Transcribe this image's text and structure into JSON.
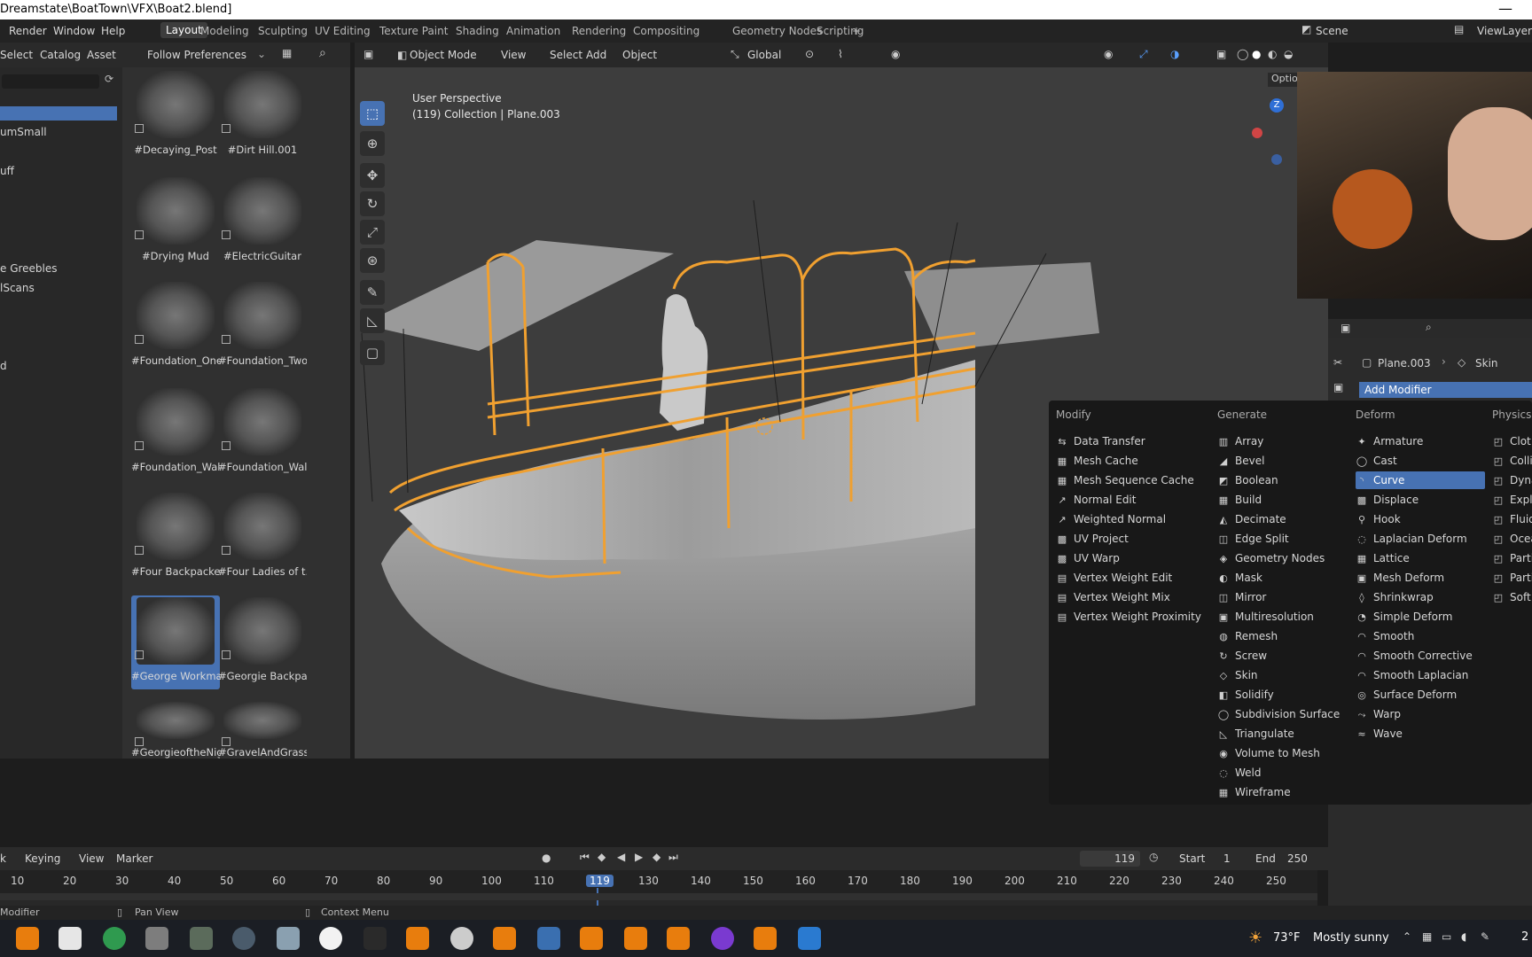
{
  "title_bar": {
    "path": "Dreamstate\\BoatTown\\VFX\\Boat2.blend]",
    "minimize": "—"
  },
  "top_menu": [
    "Render",
    "Window",
    "Help"
  ],
  "workspaces": [
    "Layout",
    "Modeling",
    "Sculpting",
    "UV Editing",
    "Texture Paint",
    "Shading",
    "Animation",
    "Rendering",
    "Compositing",
    "Geometry Nodes",
    "Scripting",
    "+"
  ],
  "scene": {
    "name": "Scene",
    "view_layer": "ViewLayer"
  },
  "asset_browser": {
    "menus": [
      "Select",
      "Catalog",
      "Asset"
    ],
    "import_mode": "Follow Preferences",
    "left_items": [
      "umSmall",
      "uff",
      "e Greebles",
      "lScans",
      "d"
    ],
    "assets": [
      {
        "label": "#Decaying_Post"
      },
      {
        "label": "#Dirt Hill.001"
      },
      {
        "label": "#Drying Mud"
      },
      {
        "label": "#ElectricGuitar"
      },
      {
        "label": "#Foundation_One"
      },
      {
        "label": "#Foundation_Two"
      },
      {
        "label": "#Foundation_Wall"
      },
      {
        "label": "#Foundation_Wal..."
      },
      {
        "label": "#Four Backpackers"
      },
      {
        "label": "#Four Ladies of t..."
      },
      {
        "label": "#George Workma..."
      },
      {
        "label": "#Georgie Backpack"
      },
      {
        "label": "#GeorgieoftheNight"
      },
      {
        "label": "#GravelAndGrass"
      }
    ]
  },
  "viewport": {
    "mode": "Object Mode",
    "menus": [
      "View",
      "Select",
      "Add",
      "Object"
    ],
    "orientation": "Global",
    "perspective": "User Perspective",
    "collection_info": "(119) Collection | Plane.003",
    "options": "Option",
    "axis_z": "Z"
  },
  "properties": {
    "object": "Plane.003",
    "modifier": "Skin",
    "add_modifier": "Add Modifier"
  },
  "modifier_menu": {
    "columns": [
      {
        "header": "Modify",
        "items": [
          {
            "icon": "⇆",
            "label": "Data Transfer"
          },
          {
            "icon": "▦",
            "label": "Mesh Cache"
          },
          {
            "icon": "▦",
            "label": "Mesh Sequence Cache"
          },
          {
            "icon": "↗",
            "label": "Normal Edit"
          },
          {
            "icon": "↗",
            "label": "Weighted Normal"
          },
          {
            "icon": "▩",
            "label": "UV Project"
          },
          {
            "icon": "▩",
            "label": "UV Warp"
          },
          {
            "icon": "▤",
            "label": "Vertex Weight Edit"
          },
          {
            "icon": "▤",
            "label": "Vertex Weight Mix"
          },
          {
            "icon": "▤",
            "label": "Vertex Weight Proximity"
          }
        ]
      },
      {
        "header": "Generate",
        "items": [
          {
            "icon": "▥",
            "label": "Array"
          },
          {
            "icon": "◢",
            "label": "Bevel"
          },
          {
            "icon": "◩",
            "label": "Boolean"
          },
          {
            "icon": "▦",
            "label": "Build"
          },
          {
            "icon": "◭",
            "label": "Decimate"
          },
          {
            "icon": "◫",
            "label": "Edge Split"
          },
          {
            "icon": "◈",
            "label": "Geometry Nodes"
          },
          {
            "icon": "◐",
            "label": "Mask"
          },
          {
            "icon": "◫",
            "label": "Mirror"
          },
          {
            "icon": "▣",
            "label": "Multiresolution"
          },
          {
            "icon": "◍",
            "label": "Remesh"
          },
          {
            "icon": "↻",
            "label": "Screw"
          },
          {
            "icon": "◇",
            "label": "Skin"
          },
          {
            "icon": "◧",
            "label": "Solidify"
          },
          {
            "icon": "◯",
            "label": "Subdivision Surface"
          },
          {
            "icon": "◺",
            "label": "Triangulate"
          },
          {
            "icon": "◉",
            "label": "Volume to Mesh"
          },
          {
            "icon": "◌",
            "label": "Weld"
          },
          {
            "icon": "▦",
            "label": "Wireframe"
          }
        ]
      },
      {
        "header": "Deform",
        "items": [
          {
            "icon": "✦",
            "label": "Armature"
          },
          {
            "icon": "◯",
            "label": "Cast"
          },
          {
            "icon": "◝",
            "label": "Curve"
          },
          {
            "icon": "▩",
            "label": "Displace"
          },
          {
            "icon": "⚲",
            "label": "Hook"
          },
          {
            "icon": "◌",
            "label": "Laplacian Deform"
          },
          {
            "icon": "▦",
            "label": "Lattice"
          },
          {
            "icon": "▣",
            "label": "Mesh Deform"
          },
          {
            "icon": "◊",
            "label": "Shrinkwrap"
          },
          {
            "icon": "◔",
            "label": "Simple Deform"
          },
          {
            "icon": "◠",
            "label": "Smooth"
          },
          {
            "icon": "◠",
            "label": "Smooth Corrective"
          },
          {
            "icon": "◠",
            "label": "Smooth Laplacian"
          },
          {
            "icon": "◎",
            "label": "Surface Deform"
          },
          {
            "icon": "⤳",
            "label": "Warp"
          },
          {
            "icon": "≈",
            "label": "Wave"
          }
        ]
      },
      {
        "header": "Physics",
        "items": [
          {
            "icon": "◰",
            "label": "Clot"
          },
          {
            "icon": "◰",
            "label": "Colli"
          },
          {
            "icon": "◰",
            "label": "Dyna"
          },
          {
            "icon": "◰",
            "label": "Expl"
          },
          {
            "icon": "◰",
            "label": "Fluid"
          },
          {
            "icon": "◰",
            "label": "Ocea"
          },
          {
            "icon": "◰",
            "label": "Parti"
          },
          {
            "icon": "◰",
            "label": "Parti"
          },
          {
            "icon": "◰",
            "label": "Soft"
          }
        ]
      }
    ],
    "highlighted": "Curve"
  },
  "timeline": {
    "menus": [
      "k",
      "Keying",
      "View",
      "Marker"
    ],
    "current_frame": "119",
    "start_label": "Start",
    "start": "1",
    "end_label": "End",
    "end": "250",
    "ticks": [
      "10",
      "20",
      "30",
      "40",
      "50",
      "60",
      "70",
      "80",
      "90",
      "100",
      "110",
      "119",
      "130",
      "140",
      "150",
      "160",
      "170",
      "180",
      "190",
      "200",
      "210",
      "220",
      "230",
      "240",
      "250"
    ]
  },
  "status_bar": {
    "left": "Modifier",
    "middle": "Pan View",
    "right": "Context Menu"
  },
  "taskbar": {
    "weather_temp": "73°F",
    "weather_desc": "Mostly sunny",
    "clock_hint": "2"
  },
  "colors": {
    "accent": "#4772b3",
    "selection_orange": "#f0a030"
  }
}
